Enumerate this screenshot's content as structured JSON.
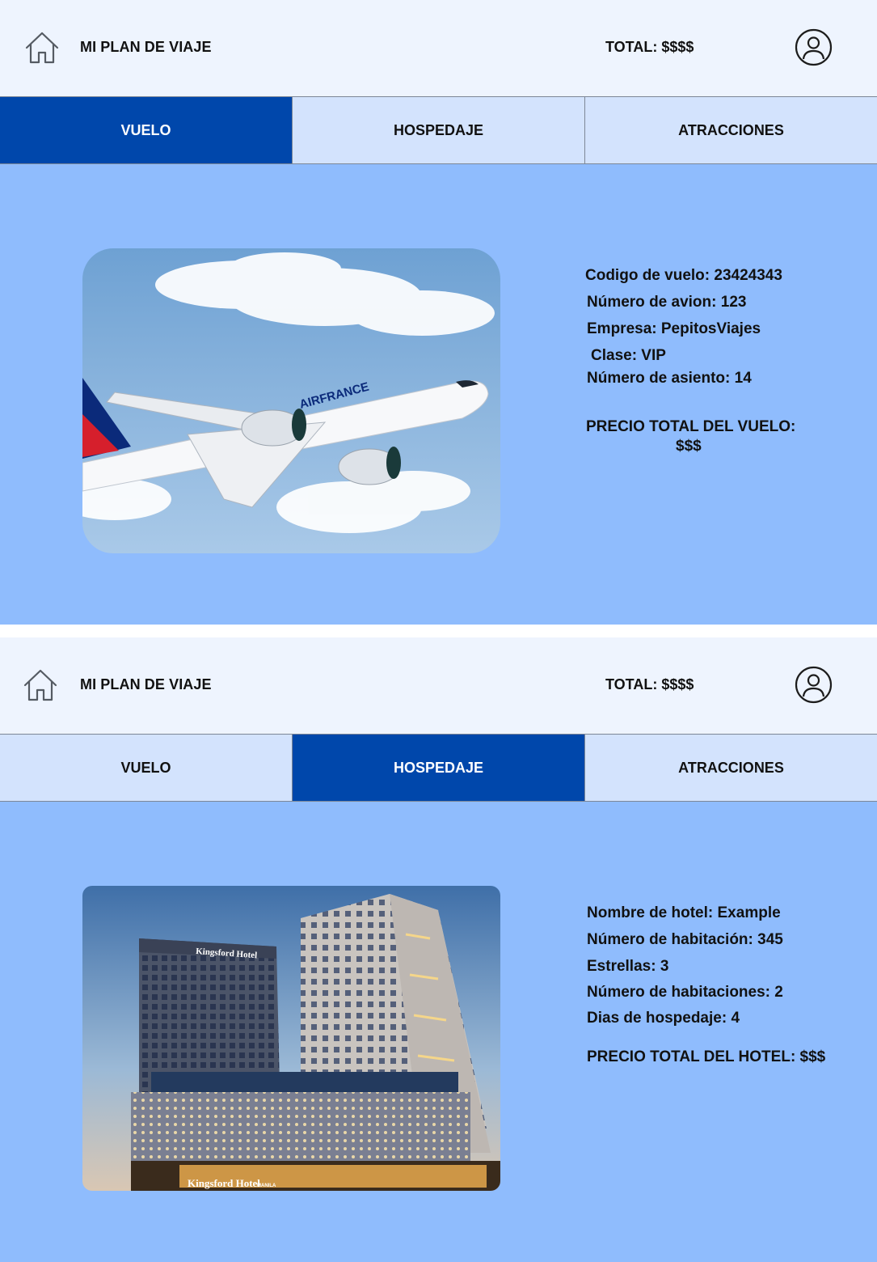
{
  "screens": [
    {
      "header": {
        "title": "MI PLAN DE VIAJE",
        "total": "TOTAL: $$$$"
      },
      "tabs": [
        {
          "label": "VUELO",
          "active": true
        },
        {
          "label": "HOSPEDAJE",
          "active": false
        },
        {
          "label": "ATRACCIONES",
          "active": false
        }
      ],
      "details": [
        "Codigo de vuelo: 23424343",
        "Número de avion: 123",
        "Empresa: PepitosViajes",
        "Clase: VIP",
        "Número de asiento: 14"
      ],
      "price_label": "PRECIO TOTAL DEL VUELO:",
      "price_value": "$$$",
      "photo": {
        "type": "airplane",
        "airline_text": "AIRFRANCE"
      }
    },
    {
      "header": {
        "title": "MI PLAN DE VIAJE",
        "total": "TOTAL: $$$$"
      },
      "tabs": [
        {
          "label": "VUELO",
          "active": false
        },
        {
          "label": "HOSPEDAJE",
          "active": true
        },
        {
          "label": "ATRACCIONES",
          "active": false
        }
      ],
      "details": [
        "Nombre de hotel: Example",
        "Número de habitación: 345",
        "Estrellas: 3",
        "Número de habitaciones: 2",
        "Dias de hospedaje: 4"
      ],
      "price_label": "PRECIO TOTAL DEL HOTEL: $$$",
      "photo": {
        "type": "hotel",
        "sign_text": "Kingsford Hotel",
        "sign_sub": "MANILA"
      }
    }
  ],
  "colors": {
    "header_bg": "#eef4fe",
    "tab_bg": "#d3e3fd",
    "tab_active_bg": "#0047ab",
    "content_bg": "#8fbcfd"
  },
  "icons": {
    "home": "home-icon",
    "user": "user-avatar-icon"
  }
}
